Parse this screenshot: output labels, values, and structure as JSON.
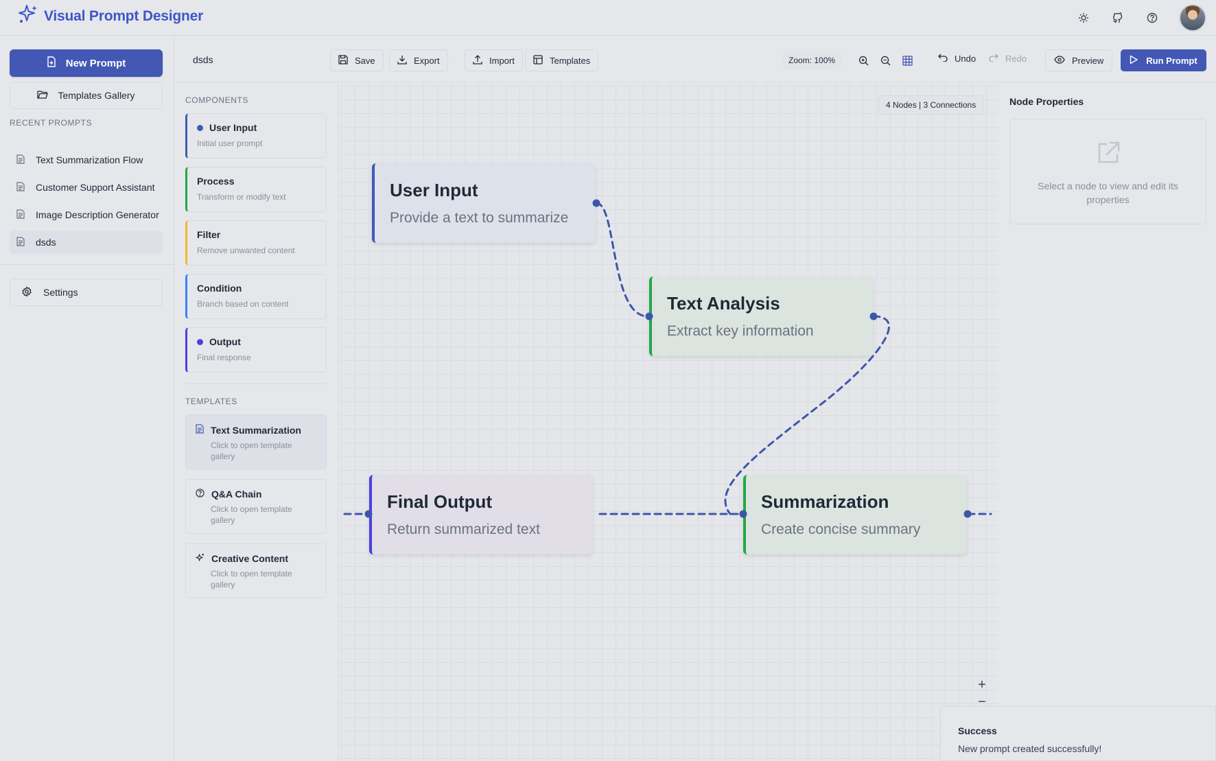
{
  "app": {
    "title": "Visual Prompt Designer"
  },
  "sidebar": {
    "new_prompt": "New Prompt",
    "templates_gallery": "Templates Gallery",
    "recent_title": "RECENT PROMPTS",
    "recent": [
      "Text Summarization Flow",
      "Customer Support Assistant",
      "Image Description Generator",
      "dsds"
    ],
    "active_recent": "dsds",
    "settings": "Settings"
  },
  "toolbar": {
    "doc_title": "dsds",
    "save": "Save",
    "export": "Export",
    "import": "Import",
    "templates": "Templates",
    "zoom": "Zoom: 100%",
    "undo": "Undo",
    "redo": "Redo",
    "preview": "Preview",
    "run": "Run Prompt"
  },
  "components": {
    "title": "COMPONENTS",
    "items": [
      {
        "name": "User Input",
        "desc": "Initial user prompt",
        "color": "#4258b4",
        "dot": true
      },
      {
        "name": "Process",
        "desc": "Transform or modify text",
        "color": "#22a846",
        "dot": false
      },
      {
        "name": "Filter",
        "desc": "Remove unwanted content",
        "color": "#f4b82e",
        "dot": false
      },
      {
        "name": "Condition",
        "desc": "Branch based on content",
        "color": "#3b82f6",
        "dot": false
      },
      {
        "name": "Output",
        "desc": "Final response",
        "color": "#4b3fe0",
        "dot": true
      }
    ]
  },
  "templates": {
    "title": "TEMPLATES",
    "items": [
      {
        "name": "Text Summarization",
        "desc": "Click to open template gallery",
        "icon": "document-icon"
      },
      {
        "name": "Q&A Chain",
        "desc": "Click to open template gallery",
        "icon": "help-circle-icon"
      },
      {
        "name": "Creative Content",
        "desc": "Click to open template gallery",
        "icon": "sparkles-icon"
      }
    ]
  },
  "canvas": {
    "stats": "4 Nodes | 3 Connections",
    "nodes": {
      "user_input": {
        "title": "User Input",
        "subtitle": "Provide a text to summarize",
        "color": "#4258b4"
      },
      "text_analysis": {
        "title": "Text Analysis",
        "subtitle": "Extract key information",
        "color": "#22a846"
      },
      "final_output": {
        "title": "Final Output",
        "subtitle": "Return summarized text",
        "color": "#4b3fe0"
      },
      "summarization": {
        "title": "Summarization",
        "subtitle": "Create concise summary",
        "color": "#22a846"
      }
    },
    "zoom_in": "+",
    "zoom_out": "−"
  },
  "properties": {
    "title": "Node Properties",
    "empty": "Select a node to view and edit its properties"
  },
  "toast": {
    "title": "Success",
    "message": "New prompt created successfully!"
  },
  "colors": {
    "accent": "#4258b4",
    "wire": "#3f55a8",
    "brand": "#3f55c9"
  }
}
